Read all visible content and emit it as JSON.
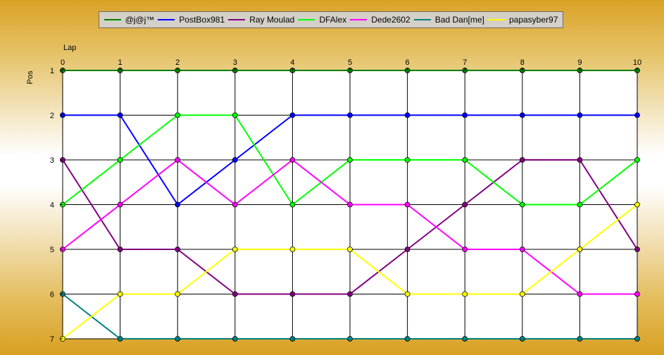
{
  "chart_data": {
    "type": "line",
    "xlabel": "Lap",
    "ylabel": "Pos",
    "x": [
      0,
      1,
      2,
      3,
      4,
      5,
      6,
      7,
      8,
      9,
      10
    ],
    "xlim": [
      0,
      10
    ],
    "ylim": [
      1,
      7
    ],
    "y_inverted": true,
    "y_ticks": [
      1,
      2,
      3,
      4,
      5,
      6,
      7
    ],
    "grid": true,
    "legend_position": "top",
    "series": [
      {
        "name": "@j@j™",
        "color": "#008000",
        "values": [
          1,
          1,
          1,
          1,
          1,
          1,
          1,
          1,
          1,
          1,
          1
        ]
      },
      {
        "name": "PostBox981",
        "color": "#0000ff",
        "values": [
          2,
          2,
          4,
          3,
          2,
          2,
          2,
          2,
          2,
          2,
          2
        ]
      },
      {
        "name": "Ray Moulad",
        "color": "#800080",
        "values": [
          3,
          5,
          5,
          6,
          6,
          6,
          5,
          4,
          3,
          3,
          5
        ]
      },
      {
        "name": "DFAlex",
        "color": "#00ff00",
        "values": [
          4,
          3,
          2,
          2,
          4,
          3,
          3,
          3,
          4,
          4,
          3
        ]
      },
      {
        "name": "Dede2602",
        "color": "#ff00ff",
        "values": [
          5,
          4,
          3,
          4,
          3,
          4,
          4,
          5,
          5,
          6,
          6
        ]
      },
      {
        "name": "Bad Dan[me]",
        "color": "#008080",
        "values": [
          6,
          7,
          7,
          7,
          7,
          7,
          7,
          7,
          7,
          7,
          7
        ]
      },
      {
        "name": "papasyber97",
        "color": "#ffff00",
        "values": [
          7,
          6,
          6,
          5,
          5,
          5,
          6,
          6,
          6,
          5,
          4
        ]
      }
    ]
  }
}
